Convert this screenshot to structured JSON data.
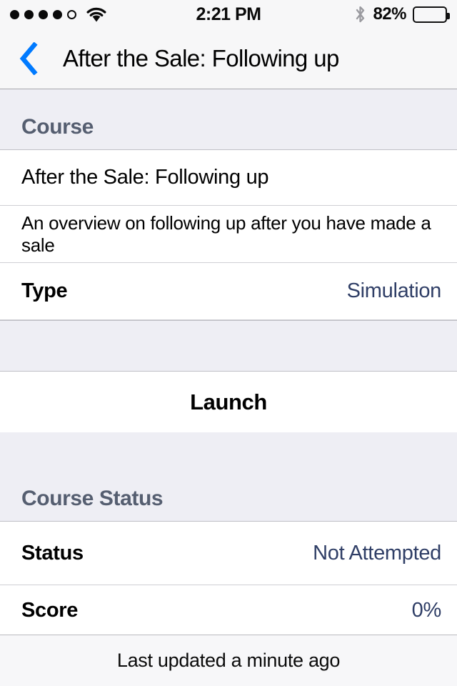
{
  "status_bar": {
    "signal_dots_filled": 4,
    "signal_dots_total": 5,
    "wifi_icon": "wifi-icon",
    "time": "2:21 PM",
    "bluetooth_icon": "bluetooth-icon",
    "battery_percent": "82%",
    "battery_level": 82
  },
  "nav": {
    "back_icon": "chevron-left-icon",
    "title": "After the Sale: Following up"
  },
  "sections": {
    "course": {
      "header": "Course",
      "title": "After the Sale: Following up",
      "description": "An overview on following up after you have made a sale",
      "type_label": "Type",
      "type_value": "Simulation"
    },
    "launch": {
      "label": "Launch"
    },
    "course_status": {
      "header": "Course Status",
      "status_label": "Status",
      "status_value": "Not Attempted",
      "score_label": "Score",
      "score_value": "0%"
    }
  },
  "footer": {
    "text": "Last updated a minute ago"
  },
  "colors": {
    "accent_blue": "#007aff",
    "value_navy": "#2f3e66",
    "section_header_text": "#555e70",
    "section_background": "#eeeef4",
    "cell_background": "#ffffff",
    "bar_background": "#f7f7f8"
  }
}
